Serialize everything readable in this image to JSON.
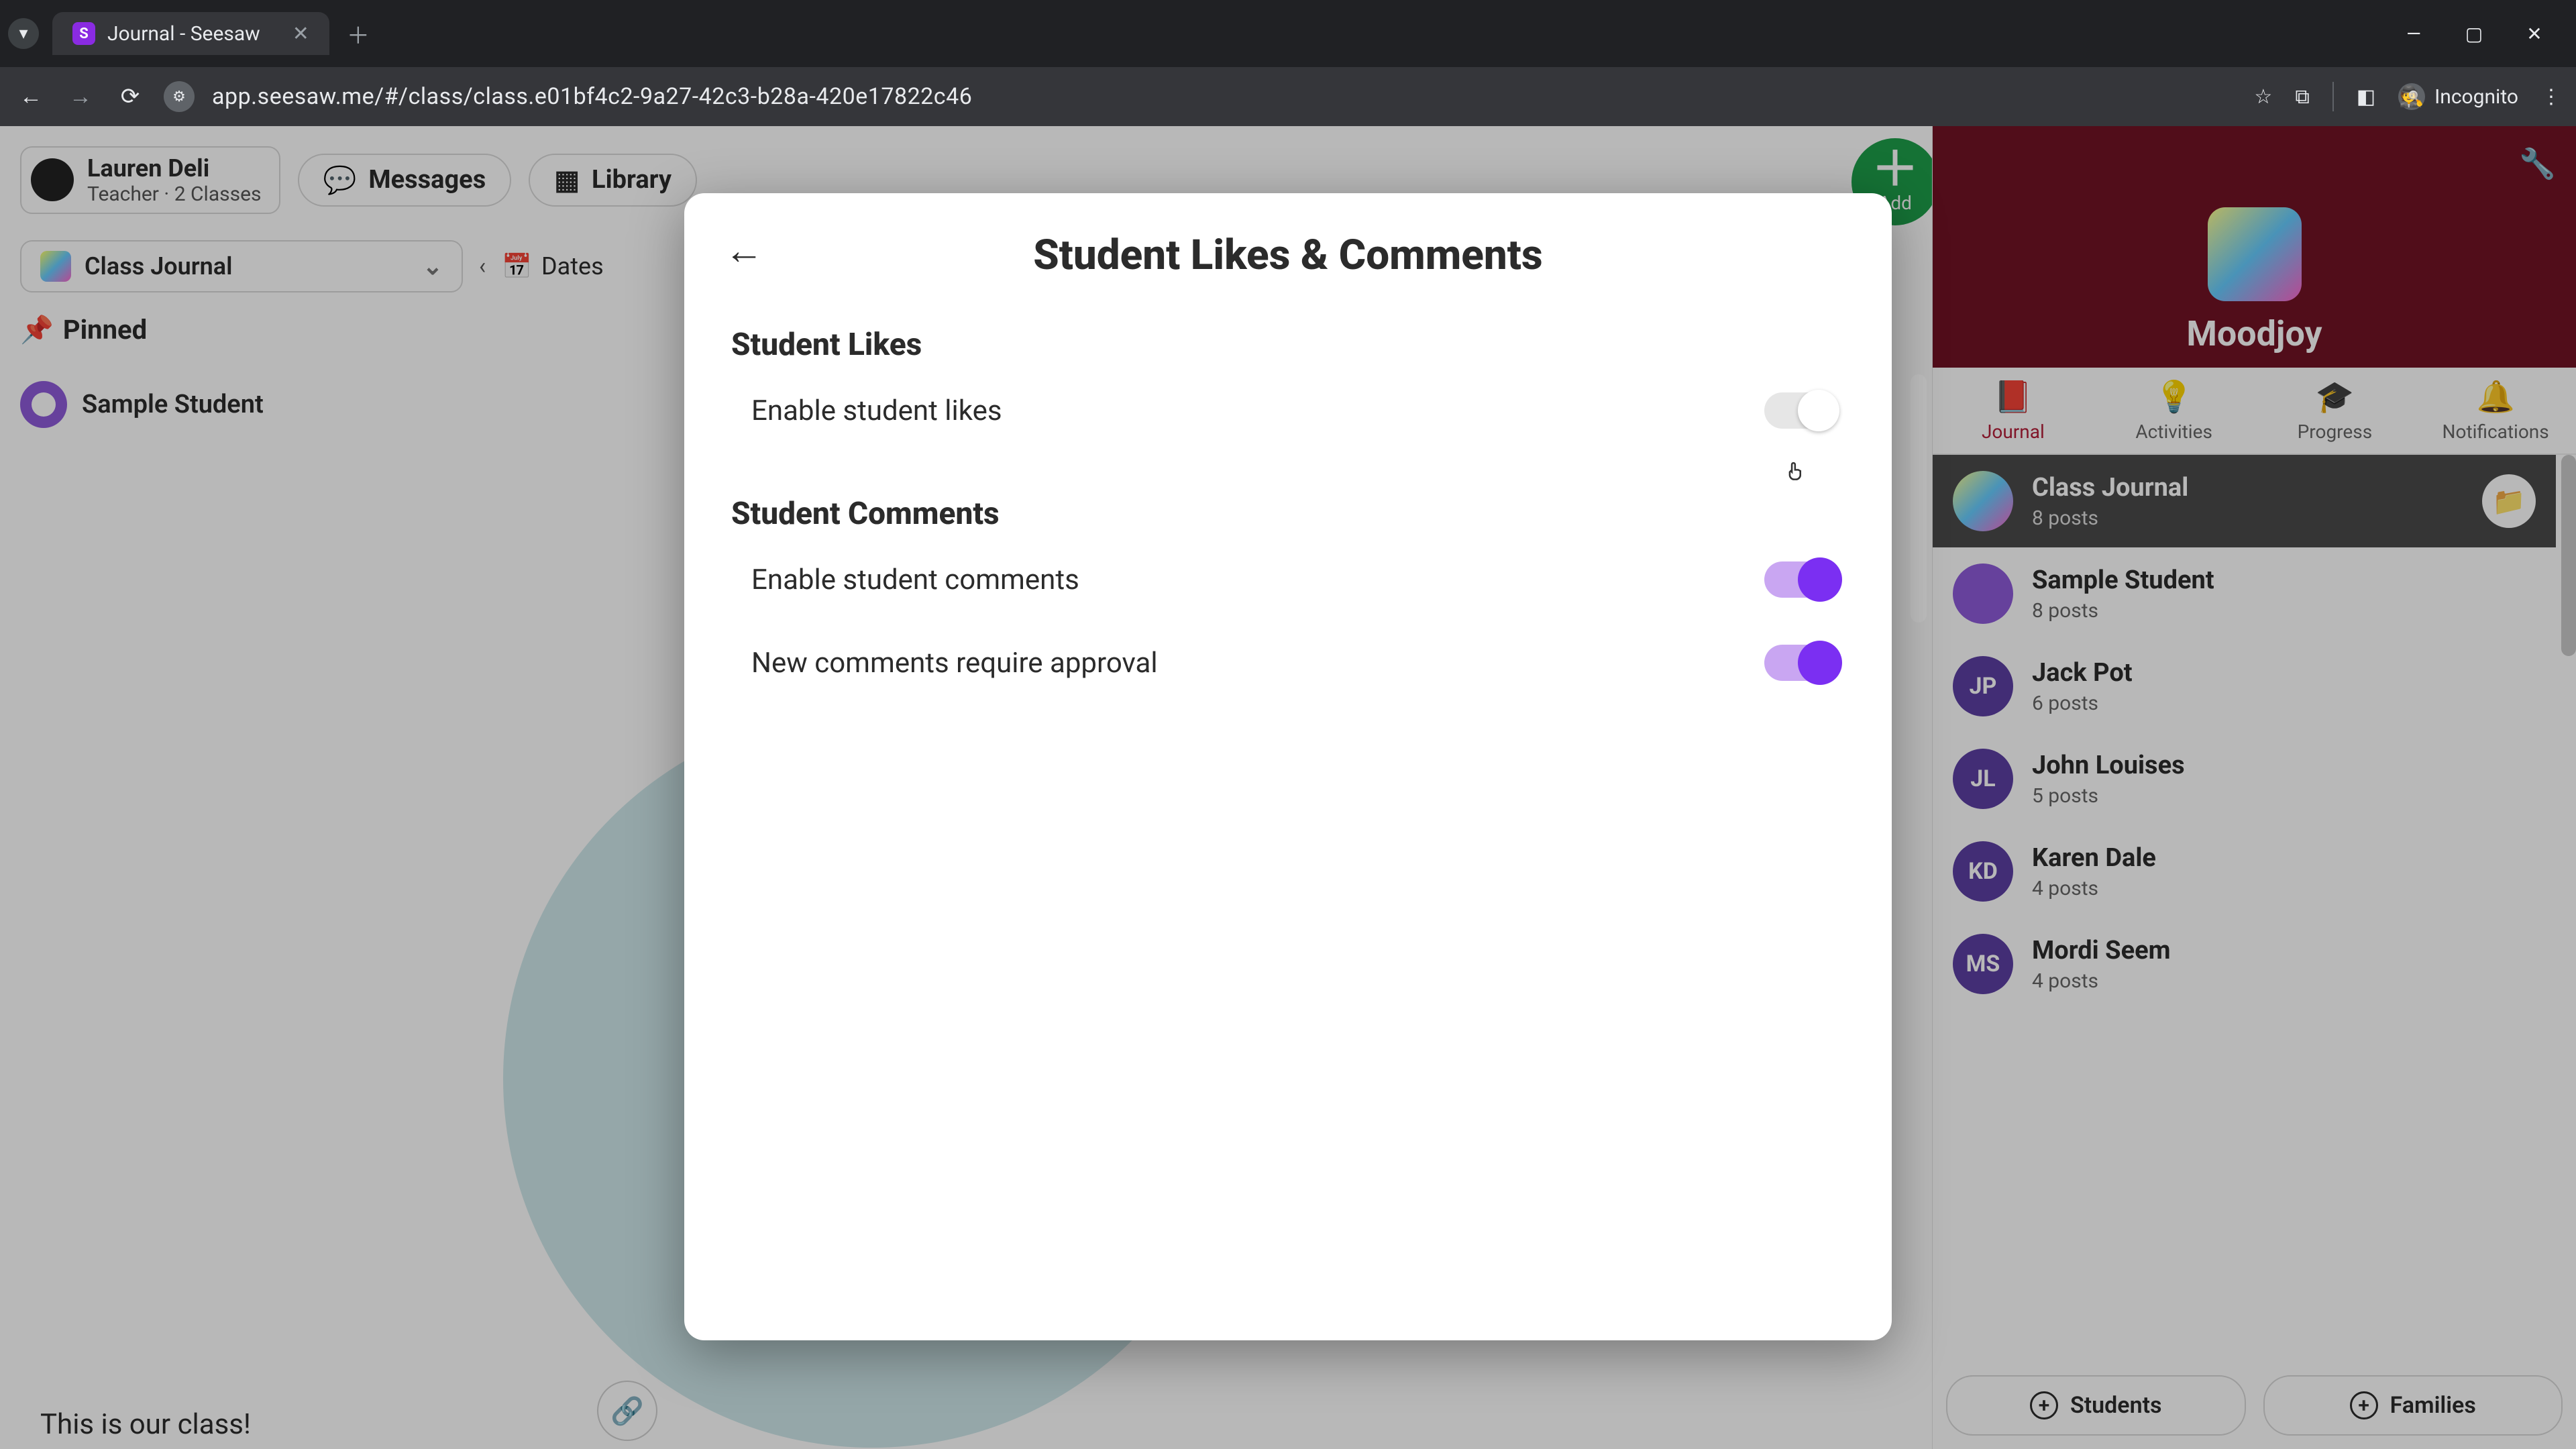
{
  "browser": {
    "tab_title": "Journal - Seesaw",
    "url": "app.seesaw.me/#/class/class.e01bf4c2-9a27-42c3-b28a-420e17822c46",
    "incognito_label": "Incognito"
  },
  "header": {
    "user_name": "Lauren Deli",
    "user_role": "Teacher · 2 Classes",
    "messages_label": "Messages",
    "library_label": "Library",
    "add_label": "Add"
  },
  "journal_bar": {
    "selector_label": "Class Journal",
    "dates_label": "Dates"
  },
  "feed": {
    "pinned_label": "Pinned",
    "sample_student": "Sample Student",
    "caption": "This is our class!"
  },
  "sidebar": {
    "class_name": "Moodjoy",
    "tabs": {
      "journal": "Journal",
      "activities": "Activities",
      "progress": "Progress",
      "notifications": "Notifications"
    },
    "items": [
      {
        "name": "Class Journal",
        "posts": "8 posts",
        "avatar_text": "",
        "avatar_color": "rainbow",
        "active": true,
        "has_folder": true
      },
      {
        "name": "Sample Student",
        "posts": "8 posts",
        "avatar_text": "",
        "avatar_color": "#8e5bd8",
        "active": false,
        "has_folder": false
      },
      {
        "name": "Jack Pot",
        "posts": "6 posts",
        "avatar_text": "JP",
        "avatar_color": "#5c3fa3",
        "active": false,
        "has_folder": false
      },
      {
        "name": "John Louises",
        "posts": "5 posts",
        "avatar_text": "JL",
        "avatar_color": "#5c3fa3",
        "active": false,
        "has_folder": false
      },
      {
        "name": "Karen Dale",
        "posts": "4 posts",
        "avatar_text": "KD",
        "avatar_color": "#5c3fa3",
        "active": false,
        "has_folder": false
      },
      {
        "name": "Mordi Seem",
        "posts": "4 posts",
        "avatar_text": "MS",
        "avatar_color": "#5c3fa3",
        "active": false,
        "has_folder": false
      }
    ],
    "students_btn": "Students",
    "families_btn": "Families"
  },
  "modal": {
    "title": "Student Likes & Comments",
    "likes_section": "Student Likes",
    "likes_row": "Enable student likes",
    "likes_on": false,
    "comments_section": "Student Comments",
    "comments_row": "Enable student comments",
    "comments_on": true,
    "approval_row": "New comments require approval",
    "approval_on": true
  }
}
